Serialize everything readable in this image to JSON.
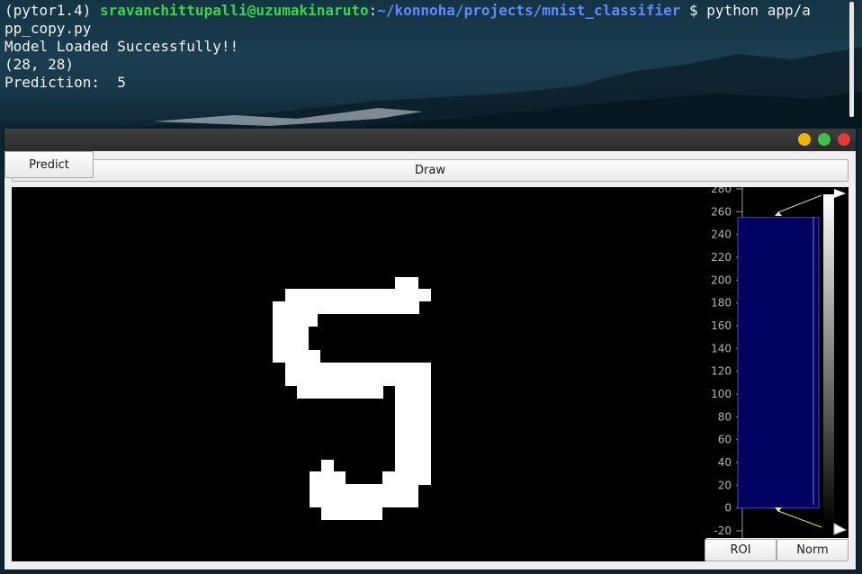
{
  "terminal": {
    "prompt_env": "(pytor1.4)",
    "prompt_user": "sravanchittupalli@uzumakinaruto",
    "prompt_sep": ":",
    "prompt_path": "~/konnoha/projects/mnist_classifier",
    "prompt_cmd_1": " $ python app/a",
    "prompt_cmd_2": "pp_copy.py",
    "output_1": "Model Loaded Successfully!!",
    "output_2": "(28, 28)",
    "output_3": "Prediction:  5"
  },
  "window": {
    "predict_label": "Predict",
    "draw_label": "Draw",
    "roi_label": "ROI",
    "norm_label": "Norm"
  },
  "histogram": {
    "ticks": [
      "280",
      "260",
      "240",
      "220",
      "200",
      "180",
      "160",
      "140",
      "120",
      "100",
      "80",
      "60",
      "40",
      "20",
      "0",
      "-20"
    ],
    "level_min": 0,
    "level_max": 255,
    "region_color": "#000060"
  },
  "colors": {
    "prompt_user": "#3fd44a",
    "prompt_path": "#5e8bff",
    "close": "#e53935",
    "minimize": "#f4b400",
    "maximize": "#3fc24a"
  },
  "icons": {
    "min": "minimize-icon",
    "max": "maximize-icon",
    "close": "close-icon"
  }
}
